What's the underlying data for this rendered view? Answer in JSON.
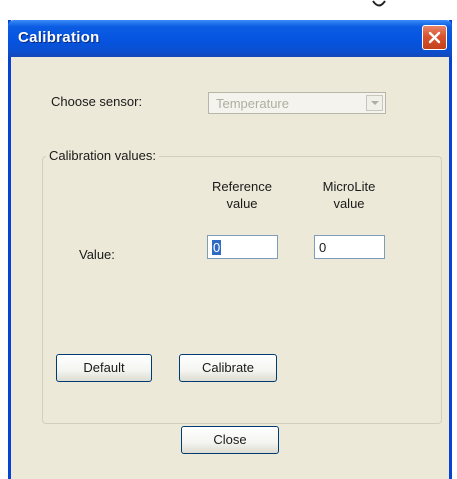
{
  "window": {
    "title": "Calibration"
  },
  "sensor": {
    "label": "Choose sensor:",
    "selected": "Temperature"
  },
  "calibration_group": {
    "title": "Calibration values:",
    "columns": {
      "reference_line1": "Reference",
      "reference_line2": "value",
      "microlite_line1": "MicroLite",
      "microlite_line2": "value"
    },
    "row_label": "Value:",
    "reference_value": "0",
    "microlite_value": "0"
  },
  "buttons": {
    "default": "Default",
    "calibrate": "Calibrate",
    "close": "Close"
  },
  "colors": {
    "titlebar": "#0654e0",
    "dialog_background": "#ece9d8",
    "close_button": "#d8532f",
    "selection": "#316ac5"
  },
  "icons": {
    "close": "close-x-icon",
    "dropdown": "chevron-down-icon"
  }
}
